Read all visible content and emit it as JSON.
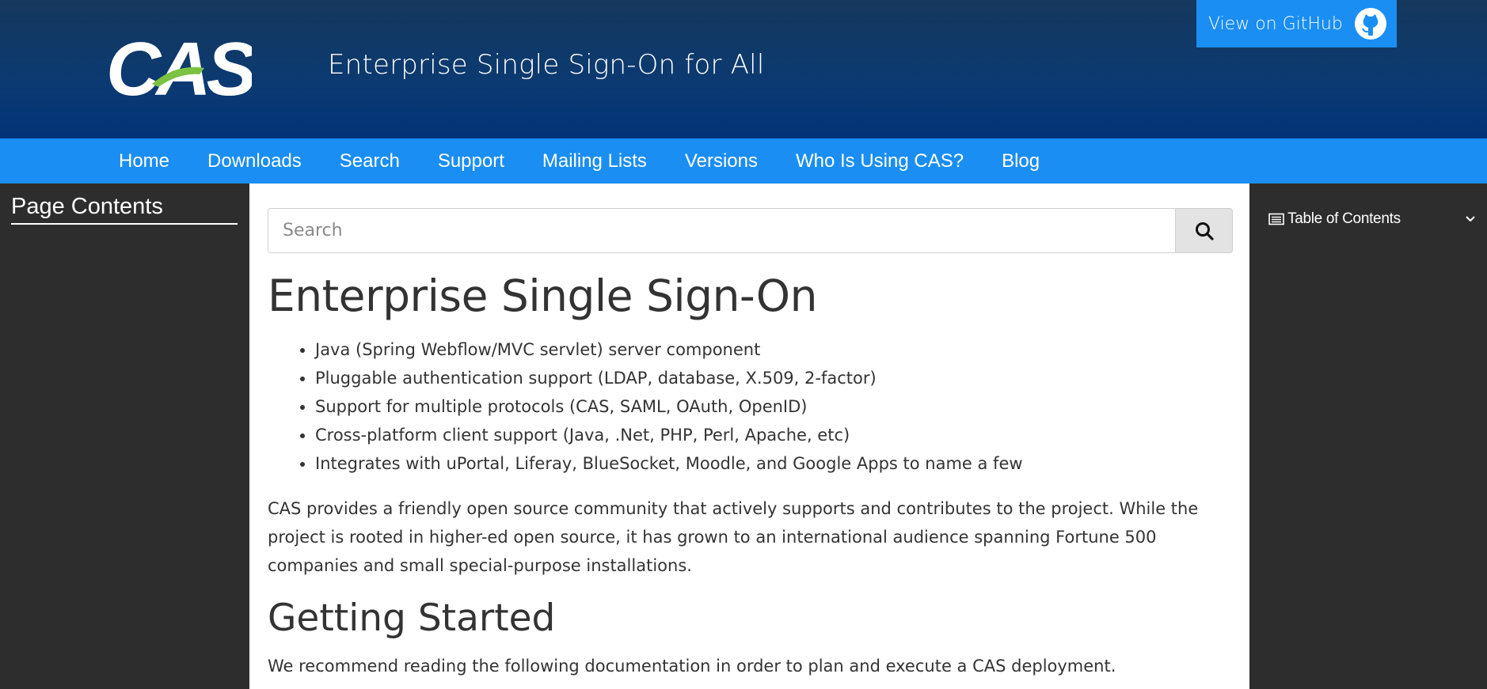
{
  "header": {
    "logo_text": "CAS",
    "tagline": "Enterprise Single Sign-On for All",
    "github_button": "View on GitHub"
  },
  "nav": {
    "items": [
      "Home",
      "Downloads",
      "Search",
      "Support",
      "Mailing Lists",
      "Versions",
      "Who Is Using CAS?",
      "Blog"
    ]
  },
  "left_sidebar": {
    "title": "Page Contents"
  },
  "search": {
    "placeholder": "Search"
  },
  "content": {
    "title": "Enterprise Single Sign-On",
    "features": [
      "Java (Spring Webflow/MVC servlet) server component",
      "Pluggable authentication support (LDAP, database, X.509, 2-factor)",
      "Support for multiple protocols (CAS, SAML, OAuth, OpenID)",
      "Cross-platform client support (Java, .Net, PHP, Perl, Apache, etc)",
      "Integrates with uPortal, Liferay, BlueSocket, Moodle, and Google Apps to name a few"
    ],
    "intro": "CAS provides a friendly open source community that actively supports and contributes to the project. While the project is rooted in higher-ed open source, it has grown to an international audience spanning Fortune 500 companies and small special-purpose installations.",
    "getting_started_title": "Getting Started",
    "getting_started_text": "We recommend reading the following documentation in order to plan and execute a CAS deployment."
  },
  "right_sidebar": {
    "toc_label": "Table of Contents"
  },
  "colors": {
    "header_bg": "#0b3a72",
    "nav_bg": "#1a8ef2",
    "sidebar_bg": "#2d2d2d",
    "logo_accent": "#7cc142"
  },
  "icons": {
    "github": "github-octocat-icon",
    "search": "search-icon",
    "toc": "list-icon",
    "chevron": "chevron-down-icon"
  }
}
